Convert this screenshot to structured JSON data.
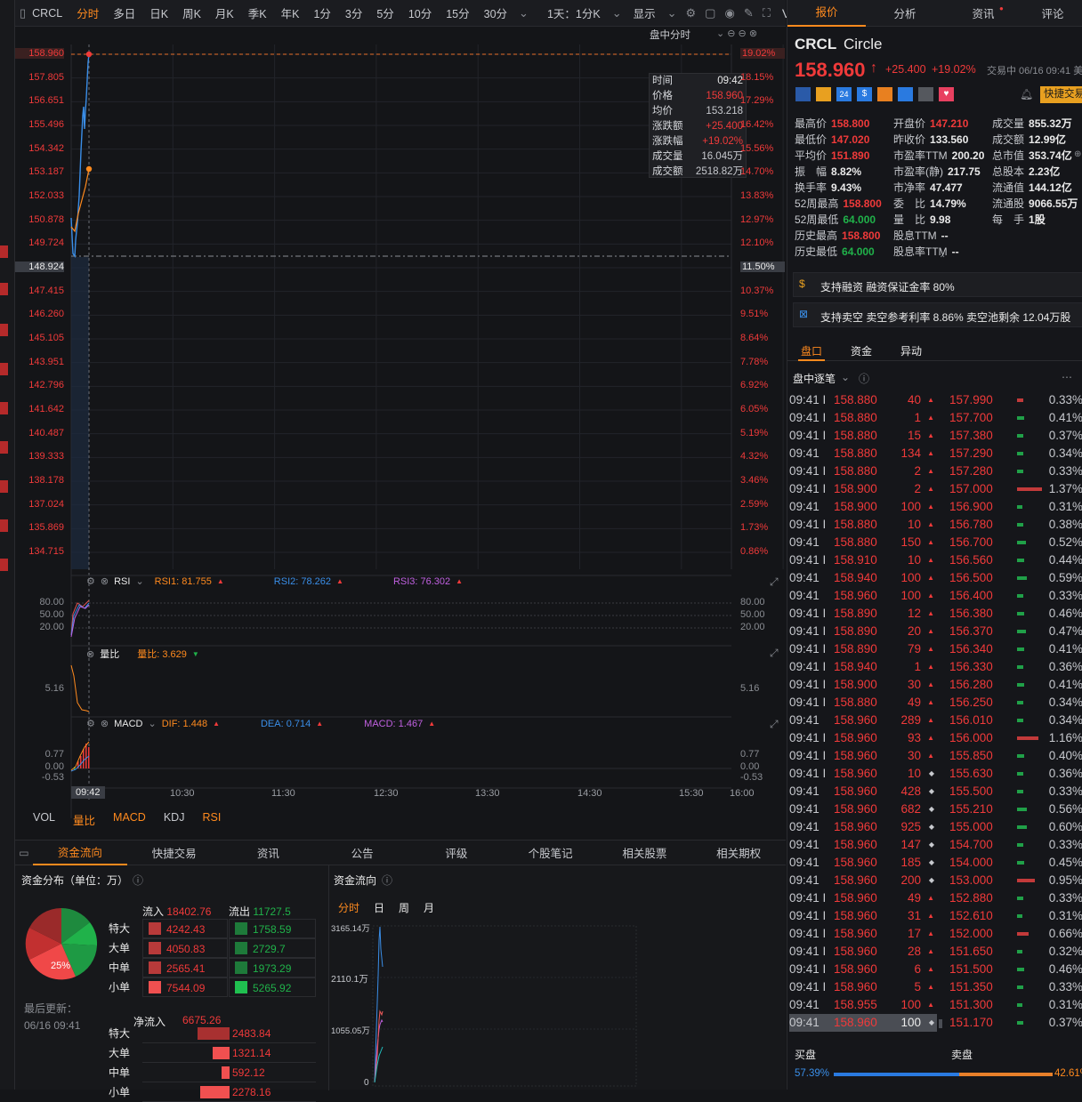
{
  "toolbar": {
    "symbol": "CRCL",
    "periods": [
      "分时",
      "多日",
      "日K",
      "周K",
      "月K",
      "季K",
      "年K",
      "1分",
      "3分",
      "5分",
      "10分",
      "15分",
      "30分"
    ],
    "interval": "1天：1分K",
    "display": "显示",
    "extra": "VS F10"
  },
  "chart": {
    "mode_label": "盘中分时",
    "left_axis": [
      "158.960",
      "157.805",
      "156.651",
      "155.496",
      "154.342",
      "153.187",
      "152.033",
      "150.878",
      "149.724",
      "148.924",
      "147.415",
      "146.260",
      "145.105",
      "143.951",
      "142.796",
      "141.642",
      "140.487",
      "139.333",
      "138.178",
      "137.024",
      "135.869",
      "134.715"
    ],
    "right_axis": [
      "19.02%",
      "18.15%",
      "17.29%",
      "16.42%",
      "15.56%",
      "14.70%",
      "13.83%",
      "12.97%",
      "12.10%",
      "11.50%",
      "10.37%",
      "9.51%",
      "8.64%",
      "7.78%",
      "6.92%",
      "6.05%",
      "5.19%",
      "4.32%",
      "3.46%",
      "2.59%",
      "1.73%",
      "0.86%"
    ],
    "tooltip": [
      {
        "k": "时间",
        "v": "09:42"
      },
      {
        "k": "价格",
        "v": "158.960"
      },
      {
        "k": "均价",
        "v": "153.218"
      },
      {
        "k": "涨跌额",
        "v": "+25.400"
      },
      {
        "k": "涨跌幅",
        "v": "+19.02%"
      },
      {
        "k": "成交量",
        "v": "16.045万"
      },
      {
        "k": "成交额",
        "v": "2518.82万"
      }
    ],
    "rsi": {
      "name": "RSI",
      "rsi1": "RSI1: 81.755",
      "rsi2": "RSI2: 78.262",
      "rsi3": "RSI3: 76.302",
      "levels": [
        "80.00",
        "50.00",
        "20.00"
      ]
    },
    "volratio": {
      "name": "量比",
      "value": "量比: 3.629",
      "level": "5.16"
    },
    "macd": {
      "name": "MACD",
      "dif": "DIF: 1.448",
      "dea": "DEA: 0.714",
      "macd": "MACD: 1.467",
      "levels": [
        "0.77",
        "0.00",
        "-0.53"
      ]
    },
    "time_axis": [
      "09:42",
      "10:30",
      "11:30",
      "12:30",
      "13:30",
      "14:30",
      "15:30",
      "16:00"
    ],
    "indicator_tabs": [
      "VOL",
      "量比",
      "MACD",
      "KDJ",
      "RSI"
    ]
  },
  "bottom": {
    "tabs": [
      "资金流向",
      "快捷交易",
      "资讯",
      "公告",
      "评级",
      "个股笔记",
      "相关股票",
      "相关期权"
    ],
    "dist_title": "资金分布（单位：万）",
    "pie_label": "25%",
    "updated_label": "最后更新：",
    "updated_time": "06/16 09:41",
    "inflow_label": "流入",
    "inflow": "18402.76",
    "outflow_label": "流出",
    "outflow": "11727.5",
    "rows": [
      {
        "name": "特大",
        "in": "4242.43",
        "out": "1758.59"
      },
      {
        "name": "大单",
        "in": "4050.83",
        "out": "2729.7"
      },
      {
        "name": "中单",
        "in": "2565.41",
        "out": "1973.29"
      },
      {
        "name": "小单",
        "in": "7544.09",
        "out": "5265.92"
      }
    ],
    "net_label": "净流入",
    "net": "6675.26",
    "net_rows": [
      {
        "name": "特大",
        "v": "2483.84",
        "frac": 0.36
      },
      {
        "name": "大单",
        "v": "1321.14",
        "frac": 0.19
      },
      {
        "name": "中单",
        "v": "592.12",
        "frac": 0.09
      },
      {
        "name": "小单",
        "v": "2278.16",
        "frac": 0.33
      }
    ],
    "flow_title": "资金流向",
    "flow_tabs": [
      "分时",
      "日",
      "周",
      "月"
    ],
    "flow_axis": [
      "3165.14万",
      "2110.1万",
      "1055.05万",
      "0"
    ]
  },
  "right": {
    "tabs": [
      "报价",
      "分析",
      "资讯",
      "评论"
    ],
    "code": "CRCL",
    "name": "Circle",
    "price": "158.960",
    "change": "+25.400",
    "change_pct": "+19.02%",
    "status": "交易中 06/16 09:41 美东",
    "quick_trade": "快捷交易",
    "stats": [
      [
        "最高价",
        "158.800",
        "red"
      ],
      [
        "开盘价",
        "147.210",
        "red"
      ],
      [
        "成交量",
        "855.32万",
        "white"
      ],
      [
        "最低价",
        "147.020",
        "red"
      ],
      [
        "昨收价",
        "133.560",
        "white"
      ],
      [
        "成交额",
        "12.99亿",
        "white"
      ],
      [
        "平均价",
        "151.890",
        "red"
      ],
      [
        "市盈率TTM",
        "200.20",
        "white"
      ],
      [
        "总市值",
        "353.74亿",
        "white"
      ],
      [
        "振　幅",
        "8.82%",
        "white"
      ],
      [
        "市盈率(静)",
        "217.75",
        "white"
      ],
      [
        "总股本",
        "2.23亿",
        "white"
      ],
      [
        "换手率",
        "9.43%",
        "white"
      ],
      [
        "市净率",
        "47.477",
        "white"
      ],
      [
        "流通值",
        "144.12亿",
        "white"
      ],
      [
        "52周最高",
        "158.800",
        "red"
      ],
      [
        "委　比",
        "14.79%",
        "white"
      ],
      [
        "流通股",
        "9066.55万",
        "white"
      ],
      [
        "52周最低",
        "64.000",
        "green"
      ],
      [
        "量　比",
        "9.98",
        "white"
      ],
      [
        "每　手",
        "1股",
        "white"
      ],
      [
        "历史最高",
        "158.800",
        "red"
      ],
      [
        "股息TTM",
        "--",
        "white"
      ],
      [
        "",
        "",
        ""
      ],
      [
        "历史最低",
        "64.000",
        "green"
      ],
      [
        "股息率TTM",
        "--",
        "white"
      ],
      [
        "",
        "",
        ""
      ]
    ],
    "margin_text": "支持融资 融资保证金率 80%",
    "short_text": "支持卖空 卖空参考利率 8.86% 卖空池剩余 12.04万股",
    "subtabs": [
      "盘口",
      "资金",
      "异动"
    ],
    "ticks_title": "盘中逐笔",
    "ticks": [
      [
        "09:41 I",
        "158.880",
        "40"
      ],
      [
        "09:41 I",
        "158.880",
        "1"
      ],
      [
        "09:41 I",
        "158.880",
        "15"
      ],
      [
        "09:41",
        "158.880",
        "134"
      ],
      [
        "09:41 I",
        "158.880",
        "2"
      ],
      [
        "09:41 I",
        "158.900",
        "2"
      ],
      [
        "09:41",
        "158.900",
        "100"
      ],
      [
        "09:41 I",
        "158.880",
        "10"
      ],
      [
        "09:41",
        "158.880",
        "150"
      ],
      [
        "09:41 I",
        "158.910",
        "10"
      ],
      [
        "09:41",
        "158.940",
        "100"
      ],
      [
        "09:41",
        "158.960",
        "100"
      ],
      [
        "09:41 I",
        "158.890",
        "12"
      ],
      [
        "09:41 I",
        "158.890",
        "20"
      ],
      [
        "09:41 I",
        "158.890",
        "79"
      ],
      [
        "09:41 I",
        "158.940",
        "1"
      ],
      [
        "09:41 I",
        "158.900",
        "30"
      ],
      [
        "09:41 I",
        "158.880",
        "49"
      ],
      [
        "09:41",
        "158.960",
        "289"
      ],
      [
        "09:41 I",
        "158.960",
        "93"
      ],
      [
        "09:41 I",
        "158.960",
        "30"
      ],
      [
        "09:41 I",
        "158.960",
        "10"
      ],
      [
        "09:41",
        "158.960",
        "428"
      ],
      [
        "09:41",
        "158.960",
        "682"
      ],
      [
        "09:41",
        "158.960",
        "925"
      ],
      [
        "09:41",
        "158.960",
        "147"
      ],
      [
        "09:41",
        "158.960",
        "185"
      ],
      [
        "09:41",
        "158.960",
        "200"
      ],
      [
        "09:41 I",
        "158.960",
        "49"
      ],
      [
        "09:41 I",
        "158.960",
        "31"
      ],
      [
        "09:41 I",
        "158.960",
        "17"
      ],
      [
        "09:41 I",
        "158.960",
        "28"
      ],
      [
        "09:41 I",
        "158.960",
        "6"
      ],
      [
        "09:41 I",
        "158.960",
        "5"
      ],
      [
        "09:41",
        "158.955",
        "100"
      ],
      [
        "09:41",
        "158.960",
        "100"
      ]
    ],
    "levels": [
      [
        "157.990",
        "0.33%",
        0.05,
        "r"
      ],
      [
        "157.700",
        "0.41%",
        0.06,
        "g"
      ],
      [
        "157.380",
        "0.37%",
        0.05,
        "g"
      ],
      [
        "157.290",
        "0.34%",
        0.05,
        "g"
      ],
      [
        "157.280",
        "0.33%",
        0.05,
        "g"
      ],
      [
        "157.000",
        "1.37%",
        0.2,
        "r"
      ],
      [
        "156.900",
        "0.31%",
        0.04,
        "g"
      ],
      [
        "156.780",
        "0.38%",
        0.05,
        "g"
      ],
      [
        "156.700",
        "0.52%",
        0.07,
        "g"
      ],
      [
        "156.560",
        "0.44%",
        0.06,
        "g"
      ],
      [
        "156.500",
        "0.59%",
        0.08,
        "g"
      ],
      [
        "156.400",
        "0.33%",
        0.05,
        "g"
      ],
      [
        "156.380",
        "0.46%",
        0.06,
        "g"
      ],
      [
        "156.370",
        "0.47%",
        0.07,
        "g"
      ],
      [
        "156.340",
        "0.41%",
        0.06,
        "g"
      ],
      [
        "156.330",
        "0.36%",
        0.05,
        "g"
      ],
      [
        "156.280",
        "0.41%",
        0.06,
        "g"
      ],
      [
        "156.250",
        "0.34%",
        0.05,
        "g"
      ],
      [
        "156.010",
        "0.34%",
        0.05,
        "g"
      ],
      [
        "156.000",
        "1.16%",
        0.17,
        "r"
      ],
      [
        "155.850",
        "0.40%",
        0.06,
        "g"
      ],
      [
        "155.630",
        "0.36%",
        0.05,
        "g"
      ],
      [
        "155.500",
        "0.33%",
        0.05,
        "g"
      ],
      [
        "155.210",
        "0.56%",
        0.08,
        "g"
      ],
      [
        "155.000",
        "0.60%",
        0.08,
        "g"
      ],
      [
        "154.700",
        "0.33%",
        0.05,
        "g"
      ],
      [
        "154.000",
        "0.45%",
        0.06,
        "g"
      ],
      [
        "153.000",
        "0.95%",
        0.14,
        "r"
      ],
      [
        "152.880",
        "0.33%",
        0.05,
        "g"
      ],
      [
        "152.610",
        "0.31%",
        0.04,
        "g"
      ],
      [
        "152.000",
        "0.66%",
        0.09,
        "r"
      ],
      [
        "151.650",
        "0.32%",
        0.04,
        "g"
      ],
      [
        "151.500",
        "0.46%",
        0.06,
        "g"
      ],
      [
        "151.350",
        "0.33%",
        0.05,
        "g"
      ],
      [
        "151.300",
        "0.31%",
        0.04,
        "g"
      ],
      [
        "151.170",
        "0.37%",
        0.05,
        "g"
      ]
    ],
    "buy_label": "买盘",
    "sell_label": "卖盘",
    "buy_pct": "57.39%",
    "sell_pct": "42.61%",
    "buy_frac": 0.5739
  }
}
